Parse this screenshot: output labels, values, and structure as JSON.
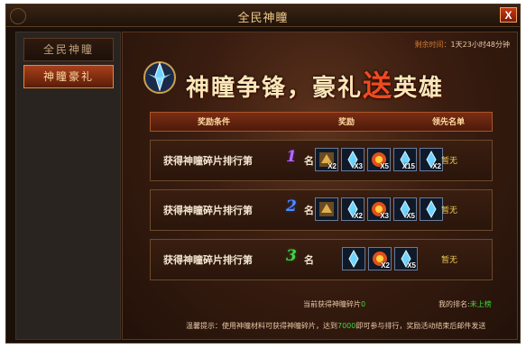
{
  "window": {
    "title": "全民神瞳",
    "close_label": "X"
  },
  "sidebar": {
    "items": [
      {
        "label": "全民神瞳"
      },
      {
        "label": "神瞳豪礼"
      }
    ]
  },
  "timer": {
    "label": "剩余时间：",
    "value": "1天23小时48分钟"
  },
  "banner": {
    "part1": "神瞳争锋，豪礼",
    "part2": "送",
    "part3": "英雄"
  },
  "table": {
    "headers": [
      "奖励条件",
      "奖励",
      "领先名单"
    ],
    "rows": [
      {
        "label": "获得神瞳碎片排行第",
        "rank": "1",
        "suffix": "名",
        "leader": "暂无",
        "items": [
          {
            "icon": "dragon-scroll-icon",
            "qty": "X2"
          },
          {
            "icon": "blue-crystal-icon",
            "qty": "X3"
          },
          {
            "icon": "fire-orb-icon",
            "qty": "X5"
          },
          {
            "icon": "blue-crystal-icon",
            "qty": "X15"
          },
          {
            "icon": "blue-crystal-icon",
            "qty": "X2"
          }
        ]
      },
      {
        "label": "获得神瞳碎片排行第",
        "rank": "2",
        "suffix": "名",
        "leader": "暂无",
        "items": [
          {
            "icon": "dragon-scroll-icon",
            "qty": ""
          },
          {
            "icon": "blue-crystal-icon",
            "qty": "X2"
          },
          {
            "icon": "fire-orb-icon",
            "qty": "X3"
          },
          {
            "icon": "blue-crystal-icon",
            "qty": "X5"
          },
          {
            "icon": "blue-crystal-icon",
            "qty": ""
          }
        ]
      },
      {
        "label": "获得神瞳碎片排行第",
        "rank": "3",
        "suffix": "名",
        "leader": "暂无",
        "items": [
          {
            "icon": "blue-crystal-icon",
            "qty": ""
          },
          {
            "icon": "fire-orb-icon",
            "qty": "X2"
          },
          {
            "icon": "blue-crystal-icon",
            "qty": "X5"
          }
        ]
      }
    ]
  },
  "footer": {
    "current_label": "当前获得神瞳碎片",
    "current_value": "0",
    "my_rank_label": "我的排名:",
    "my_rank_value": "未上榜",
    "tip_prefix": "温馨提示：使用神瞳材料可获得神瞳碎片，达到",
    "tip_highlight": "7000",
    "tip_suffix": "即可参与排行，奖励活动结束后邮件发送"
  }
}
